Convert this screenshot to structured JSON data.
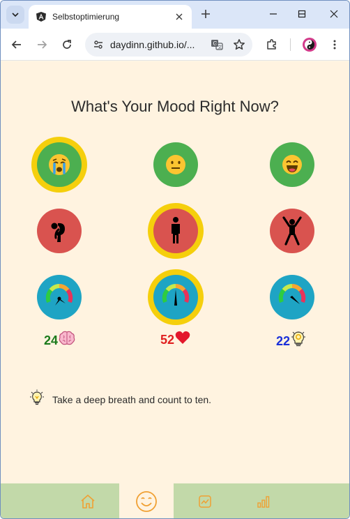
{
  "browser": {
    "tab_title": "Selbstoptimierung",
    "url": "daydinn.github.io/..."
  },
  "page": {
    "title": "What's Your Mood Right Now?",
    "scores": [
      {
        "value": "24",
        "emoji": "🧠",
        "color": "#1b7a1b"
      },
      {
        "value": "52",
        "emoji": "❤️",
        "color": "#e02020"
      },
      {
        "value": "22",
        "emoji": "💡",
        "color": "#1a2fd9"
      }
    ],
    "tip": "Take a deep breath and count to ten."
  },
  "icons": {
    "moods": [
      "crying-face",
      "neutral-face",
      "laughing-face"
    ],
    "bodies": [
      "slumped-person",
      "standing-person",
      "jumping-person"
    ],
    "gauges": [
      "gauge-low",
      "gauge-mid",
      "gauge-high"
    ],
    "bottom_nav": [
      "home",
      "smiley",
      "trend-chart",
      "bar-chart"
    ]
  },
  "selection": {
    "mood": 0,
    "body": 1,
    "gauge": 1
  },
  "bottom_nav_active": 1
}
